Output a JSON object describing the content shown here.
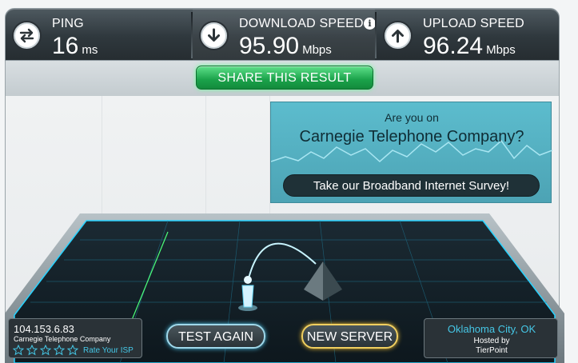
{
  "metrics": {
    "ping": {
      "label": "PING",
      "value": "16",
      "unit": "ms",
      "icon": "ping-arrows-icon"
    },
    "download": {
      "label": "DOWNLOAD SPEED",
      "value": "95.90",
      "unit": "Mbps",
      "icon": "download-arrow-icon",
      "info_glyph": "i"
    },
    "upload": {
      "label": "UPLOAD SPEED",
      "value": "96.24",
      "unit": "Mbps",
      "icon": "upload-arrow-icon"
    }
  },
  "share": {
    "label": "SHARE THIS RESULT"
  },
  "survey": {
    "question_line1": "Are you on",
    "question_line2": "Carnegie Telephone Company?",
    "button_label": "Take our Broadband Internet Survey!"
  },
  "isp": {
    "ip": "104.153.6.83",
    "name": "Carnegie Telephone Company",
    "rating_stars": 0,
    "rating_max": 5,
    "rate_label": "Rate Your ISP"
  },
  "actions": {
    "test_again": "TEST AGAIN",
    "new_server": "NEW SERVER"
  },
  "server": {
    "city": "Oklahoma City, OK",
    "hosted_by_label": "Hosted by",
    "host": "TierPoint"
  },
  "colors": {
    "accent_green": "#1aa24a",
    "accent_cyan": "#45c7e6",
    "accent_gold": "#f0cf60",
    "survey_teal": "#56bacc"
  }
}
